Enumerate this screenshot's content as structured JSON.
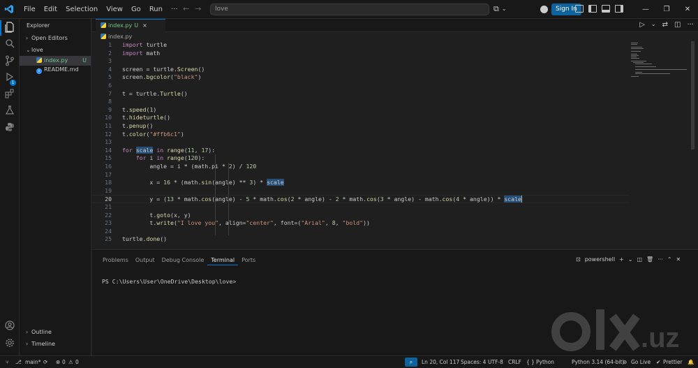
{
  "titlebar": {
    "menu": [
      "File",
      "Edit",
      "Selection",
      "View",
      "Go",
      "Run"
    ],
    "more_menu": "···",
    "search_text": "love",
    "sign_in": "Sign In"
  },
  "sidebar": {
    "title": "Explorer",
    "open_editors": "Open Editors",
    "folder": "love",
    "files": [
      {
        "name": "index.py",
        "status": "U"
      },
      {
        "name": "README.md",
        "status": ""
      }
    ],
    "outline": "Outline",
    "timeline": "Timeline"
  },
  "editor": {
    "tab": {
      "name": "index.py",
      "status": "U",
      "close": "×"
    },
    "breadcrumb": "index.py",
    "lines": [
      "1",
      "2",
      "3",
      "4",
      "5",
      "6",
      "7",
      "8",
      "9",
      "10",
      "11",
      "12",
      "13",
      "14",
      "15",
      "16",
      "17",
      "18",
      "19",
      "20",
      "21",
      "22",
      "23",
      "24",
      "25"
    ],
    "current_line": 20
  },
  "panel": {
    "tabs": [
      "Problems",
      "Output",
      "Debug Console",
      "Terminal",
      "Ports"
    ],
    "active_tab": "Terminal",
    "shell": "powershell",
    "prompt": "PS C:\\Users\\User\\OneDrive\\Desktop\\love>"
  },
  "statusbar": {
    "branch": "main*",
    "errors": "0",
    "warnings": "0",
    "position": "Ln 20, Col 117",
    "spaces": "Spaces: 4",
    "encoding": "UTF-8",
    "eol": "CRLF",
    "language": "Python",
    "lang_braces": "{ }",
    "interpreter": "Python 3.14 (64-bit)",
    "live": "Go Live",
    "prettier": "Prettier"
  },
  "watermark": {
    "text": "olx.uz"
  },
  "colors": {
    "accent": "#0078d4",
    "untracked": "#73c991",
    "keyword": "#c586c0",
    "string": "#ce9178",
    "number": "#b5cea8",
    "function": "#dcdcaa"
  }
}
